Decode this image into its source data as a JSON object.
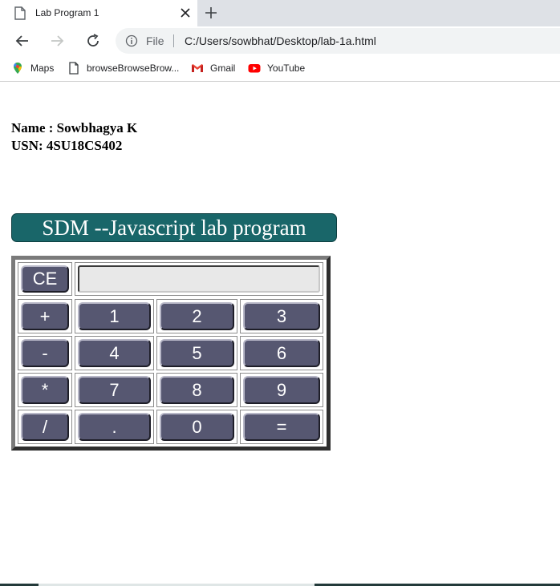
{
  "browser": {
    "tab_title": "Lab Program 1",
    "address_scheme": "File",
    "address_url": "C:/Users/sowbhat/Desktop/lab-1a.html",
    "bookmarks": [
      {
        "label": "Maps",
        "icon": "maps-icon"
      },
      {
        "label": "browseBrowseBrow...",
        "icon": "page-icon"
      },
      {
        "label": "Gmail",
        "icon": "gmail-icon"
      },
      {
        "label": "YouTube",
        "icon": "youtube-icon"
      }
    ]
  },
  "page": {
    "name_line": "Name : Sowbhagya K",
    "usn_line": "USN: 4SU18CS402",
    "heading": "SDM --Javascript lab program"
  },
  "calculator": {
    "display_value": "",
    "clear_label": "CE",
    "rows": [
      [
        "+",
        "1",
        "2",
        "3"
      ],
      [
        "-",
        "4",
        "5",
        "6"
      ],
      [
        "*",
        "7",
        "8",
        "9"
      ],
      [
        "/",
        ".",
        "0",
        "="
      ]
    ]
  },
  "colors": {
    "heading_bg": "#196669",
    "button_bg": "#565771",
    "display_bg": "#e8e8e8"
  }
}
